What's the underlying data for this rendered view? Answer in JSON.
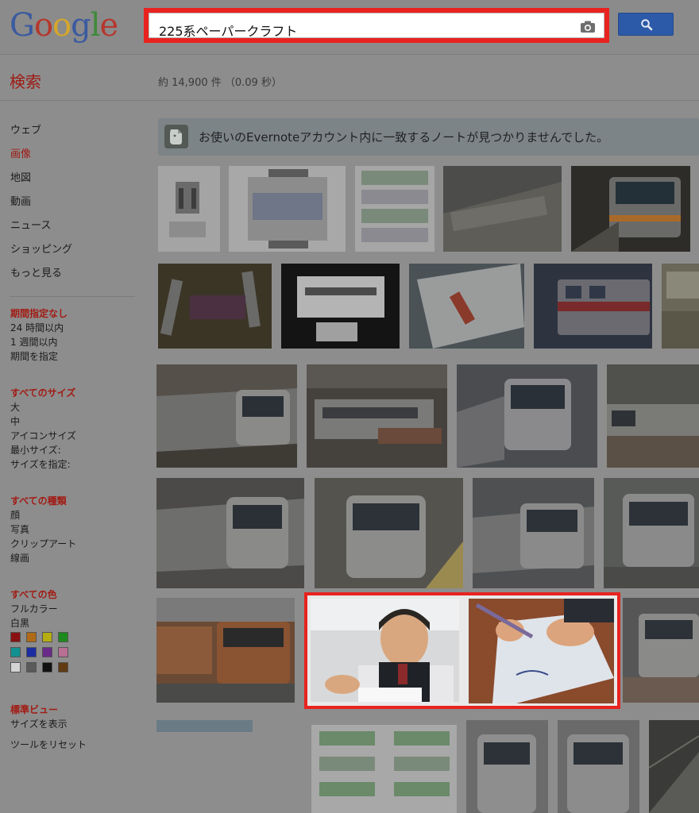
{
  "header": {
    "logo": {
      "letters": [
        "G",
        "o",
        "o",
        "g",
        "l",
        "e"
      ],
      "colors": [
        "#3a5aa0",
        "#b5372d",
        "#d6a72a",
        "#3a5aa0",
        "#3f8a3a",
        "#b5372d"
      ]
    },
    "search": {
      "query": "225系ペーパークラフト"
    },
    "search_button": {
      "icon": "magnifier-icon"
    },
    "camera": {
      "icon": "camera-icon"
    }
  },
  "subheader": {
    "search_label": "検索",
    "result_stats": "約 14,900 件 （0.09 秒）"
  },
  "leftnav": {
    "types": [
      "ウェブ",
      "画像",
      "地図",
      "動画",
      "ニュース",
      "ショッピング",
      "もっと見る"
    ],
    "active": "画像",
    "time": {
      "head": "期間指定なし",
      "items": [
        "24 時間以内",
        "1 週間以内",
        "期間を指定"
      ]
    },
    "size": {
      "head": "すべてのサイズ",
      "items": [
        "大",
        "中",
        "アイコンサイズ",
        "最小サイズ:",
        "サイズを指定:"
      ]
    },
    "kind": {
      "head": "すべての種類",
      "items": [
        "顔",
        "写真",
        "クリップアート",
        "線画"
      ]
    },
    "color": {
      "head": "すべての色",
      "items": [
        "フルカラー",
        "白黒"
      ],
      "swatches": [
        "#8a1111",
        "#b06a16",
        "#b5ad11",
        "#1d8a1d",
        "#139090",
        "#1b2da0",
        "#6a2a8a",
        "#b86f92",
        "#d4d4d4",
        "#5a5a5a",
        "#111111",
        "#5f3a12"
      ]
    },
    "view": {
      "head": "標準ビュー",
      "items": [
        "サイズを表示",
        "ツールをリセット"
      ]
    }
  },
  "evernote": {
    "message": "お使いのEvernoteアカウント内に一致するノートが見つかりませんでした。",
    "icon": "evernote-elephant-icon"
  },
  "images": {
    "row1": [
      {
        "kind": "papercraft",
        "bg": "#a4a4a4"
      },
      {
        "kind": "papercraft",
        "bg": "#a8a8a8"
      },
      {
        "kind": "papercraft",
        "bg": "#a6a6a6"
      },
      {
        "kind": "photo",
        "bg": "#4c4c4a"
      },
      {
        "kind": "photo",
        "bg": "#2e2c28"
      }
    ],
    "row2": [
      {
        "kind": "photo",
        "bg": "#3b3526"
      },
      {
        "kind": "photo",
        "bg": "#141414"
      },
      {
        "kind": "photo",
        "bg": "#4a5256"
      },
      {
        "kind": "photo",
        "bg": "#2e3340"
      },
      {
        "kind": "photo",
        "bg": "#6a6658"
      }
    ],
    "row3": [
      {
        "kind": "photo",
        "bg": "#55504a"
      },
      {
        "kind": "photo",
        "bg": "#45423e"
      },
      {
        "kind": "photo",
        "bg": "#4a4c50"
      },
      {
        "kind": "photo",
        "bg": "#50504c"
      }
    ],
    "row4": [
      {
        "kind": "photo",
        "bg": "#4b4a48"
      },
      {
        "kind": "photo",
        "bg": "#55534e"
      },
      {
        "kind": "photo",
        "bg": "#4e5052"
      },
      {
        "kind": "photo",
        "bg": "#585a58"
      }
    ],
    "row5": [
      {
        "kind": "photo",
        "bg": "#6b4a35"
      },
      {
        "kind": "photo",
        "bg": "#ececec",
        "highlight": true
      },
      {
        "kind": "photo",
        "bg": "#7a3a22",
        "highlight": true
      },
      {
        "kind": "photo",
        "bg": "#565656"
      }
    ],
    "row6": [
      {
        "kind": "photo",
        "bg": "#6a7b86"
      },
      {
        "kind": "papercraft",
        "bg": "#a8a8a8"
      },
      {
        "kind": "photo",
        "bg": "#6b6b6b"
      },
      {
        "kind": "photo",
        "bg": "#6a6a6a"
      },
      {
        "kind": "photo",
        "bg": "#3a3a38"
      }
    ]
  }
}
